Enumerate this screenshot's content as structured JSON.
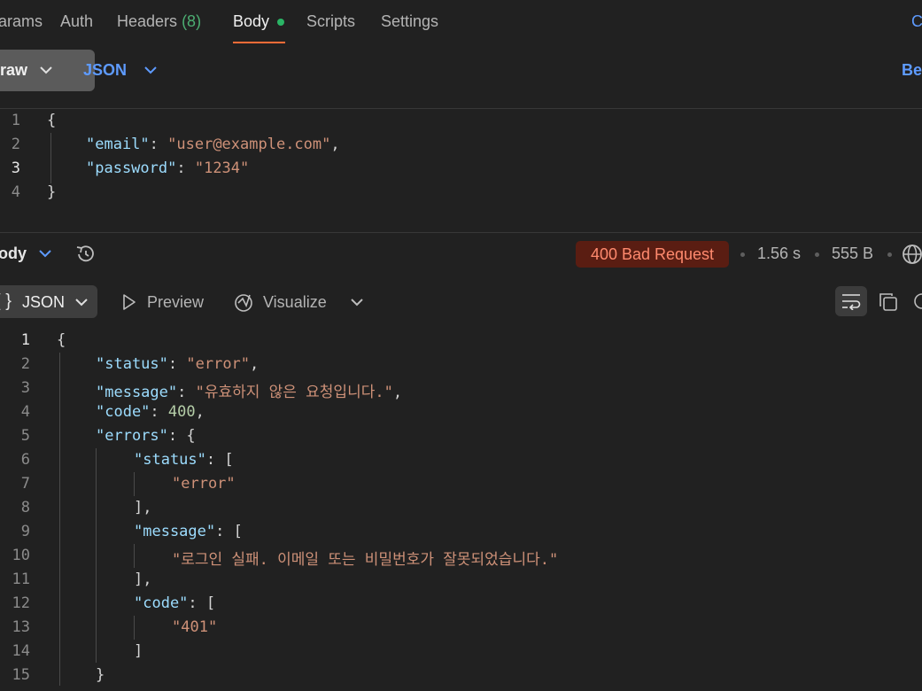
{
  "request_tabs": [
    {
      "label": "arams"
    },
    {
      "label": "Auth"
    },
    {
      "label": "Headers",
      "count": "(8)"
    },
    {
      "label": "Body",
      "active": true
    },
    {
      "label": "Scripts"
    },
    {
      "label": "Settings"
    }
  ],
  "top_right_link": "C",
  "body_type": "raw",
  "body_format": "JSON",
  "beautify_link": "Be",
  "request_code": {
    "line_numbers": [
      "1",
      "2",
      "3",
      "4"
    ],
    "open": "{",
    "email_key": "\"email\"",
    "email_val": "\"user@example.com\"",
    "password_key": "\"password\"",
    "password_val": "\"1234\"",
    "close": "}"
  },
  "response": {
    "tab_label": "ody",
    "status": "400 Bad Request",
    "time": "1.56 s",
    "size": "555 B",
    "view_format": "JSON",
    "view_format_brace": "{ }",
    "preview_label": "Preview",
    "visualize_label": "Visualize",
    "line_numbers": [
      "1",
      "2",
      "3",
      "4",
      "5",
      "6",
      "7",
      "8",
      "9",
      "10",
      "11",
      "12",
      "13",
      "14",
      "15"
    ],
    "code": {
      "status_key": "\"status\"",
      "status_val": "\"error\"",
      "message_key": "\"message\"",
      "message_val": "\"유효하지 않은 요청입니다.\"",
      "code_key": "\"code\"",
      "code_val": "400",
      "errors_key": "\"errors\"",
      "err_status_key": "\"status\"",
      "err_status_val": "\"error\"",
      "err_message_key": "\"message\"",
      "err_message_val": "\"로그인 실패. 이메일 또는 비밀번호가 잘못되었습니다.\"",
      "err_code_key": "\"code\"",
      "err_code_val": "\"401\""
    }
  },
  "colors": {
    "background": "#212121",
    "accent": "#ff6c37",
    "active_dot": "#2ab465",
    "link_blue": "#5e9bff",
    "error_badge": "#5a1d12"
  },
  "icons": [
    "chevron-down-icon",
    "history-icon",
    "play-icon",
    "visualize-icon",
    "wrap-lines-icon",
    "copy-icon",
    "globe-icon",
    "search-icon"
  ]
}
